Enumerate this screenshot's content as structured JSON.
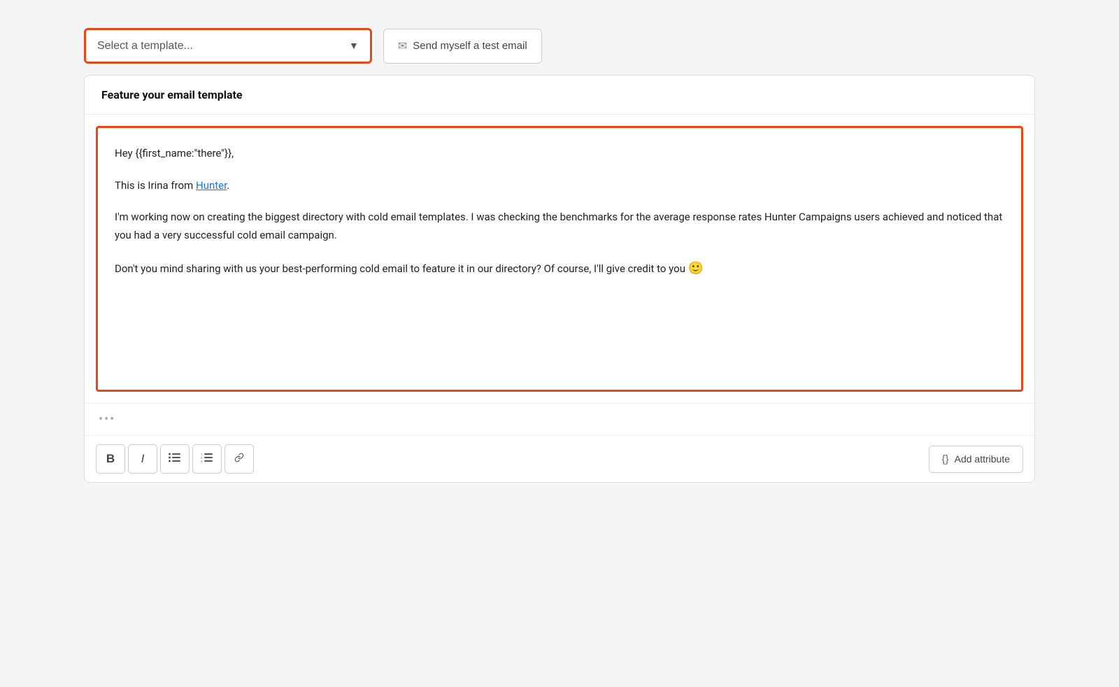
{
  "topbar": {
    "select_placeholder": "Select a template...",
    "test_email_label": "Send myself a test email"
  },
  "card": {
    "title": "Feature your email template",
    "editor": {
      "line1": "Hey {{first_name:\"there\"}},",
      "line2_prefix": "This is Irina from ",
      "line2_link_text": "Hunter",
      "line2_suffix": ".",
      "line3": "I'm working now on creating the biggest directory with cold email templates. I was checking the benchmarks for the average response rates Hunter Campaigns users achieved and noticed that you had a very successful cold email campaign.",
      "line4_prefix": "Don't you mind sharing with us your best-performing cold email to feature it in our directory? Of course, I'll give credit to you ",
      "line4_emoji": "🙂"
    },
    "dots": "•••",
    "toolbar": {
      "bold_label": "B",
      "italic_label": "I",
      "unordered_list_label": "≡",
      "ordered_list_label": "≣",
      "link_label": "🔗",
      "add_attribute_label": "Add attribute"
    }
  }
}
